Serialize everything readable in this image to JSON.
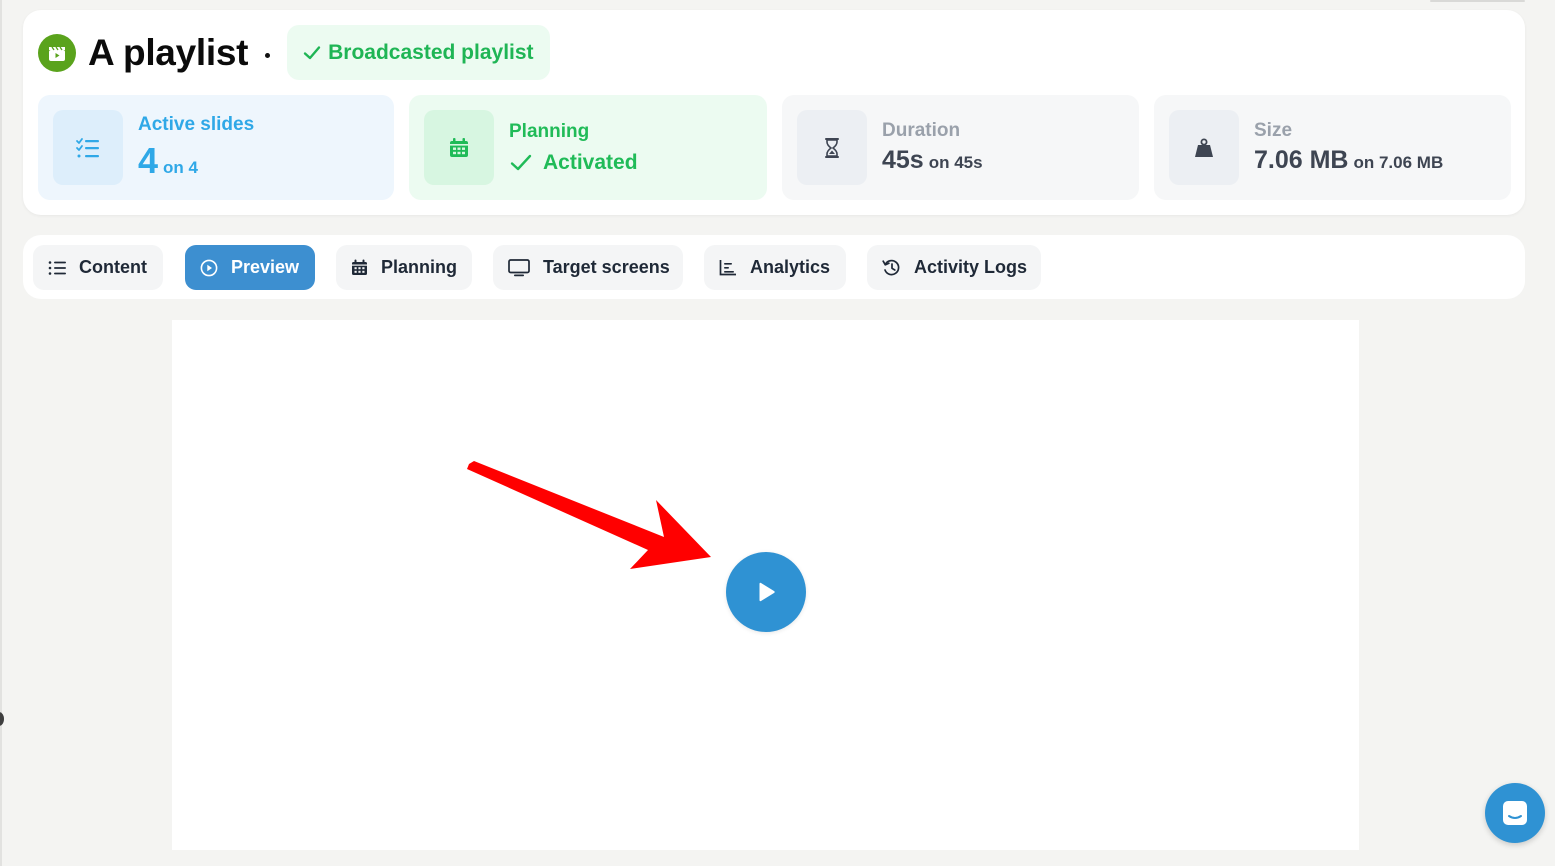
{
  "playlist": {
    "title": "A playlist",
    "status": "Broadcasted playlist"
  },
  "stats": {
    "active_slides": {
      "label": "Active slides",
      "value": "4",
      "total": "on 4"
    },
    "planning": {
      "label": "Planning",
      "value": "Activated"
    },
    "duration": {
      "label": "Duration",
      "value": "45s",
      "total": "on 45s"
    },
    "size": {
      "label": "Size",
      "value": "7.06 MB",
      "total": "on 7.06 MB"
    }
  },
  "tabs": [
    {
      "label": "Content",
      "icon": "list-icon",
      "active": false
    },
    {
      "label": "Preview",
      "icon": "play-circle-icon",
      "active": true
    },
    {
      "label": "Planning",
      "icon": "calendar-icon",
      "active": false
    },
    {
      "label": "Target screens",
      "icon": "monitor-icon",
      "active": false
    },
    {
      "label": "Analytics",
      "icon": "chart-icon",
      "active": false
    },
    {
      "label": "Activity Logs",
      "icon": "history-icon",
      "active": false
    }
  ],
  "colors": {
    "accent_blue": "#2f92d3",
    "active_tab": "#3d8fd0",
    "success_green": "#20bb58",
    "info_blue": "#2fa8e7",
    "annotation_red": "#ff0000"
  }
}
